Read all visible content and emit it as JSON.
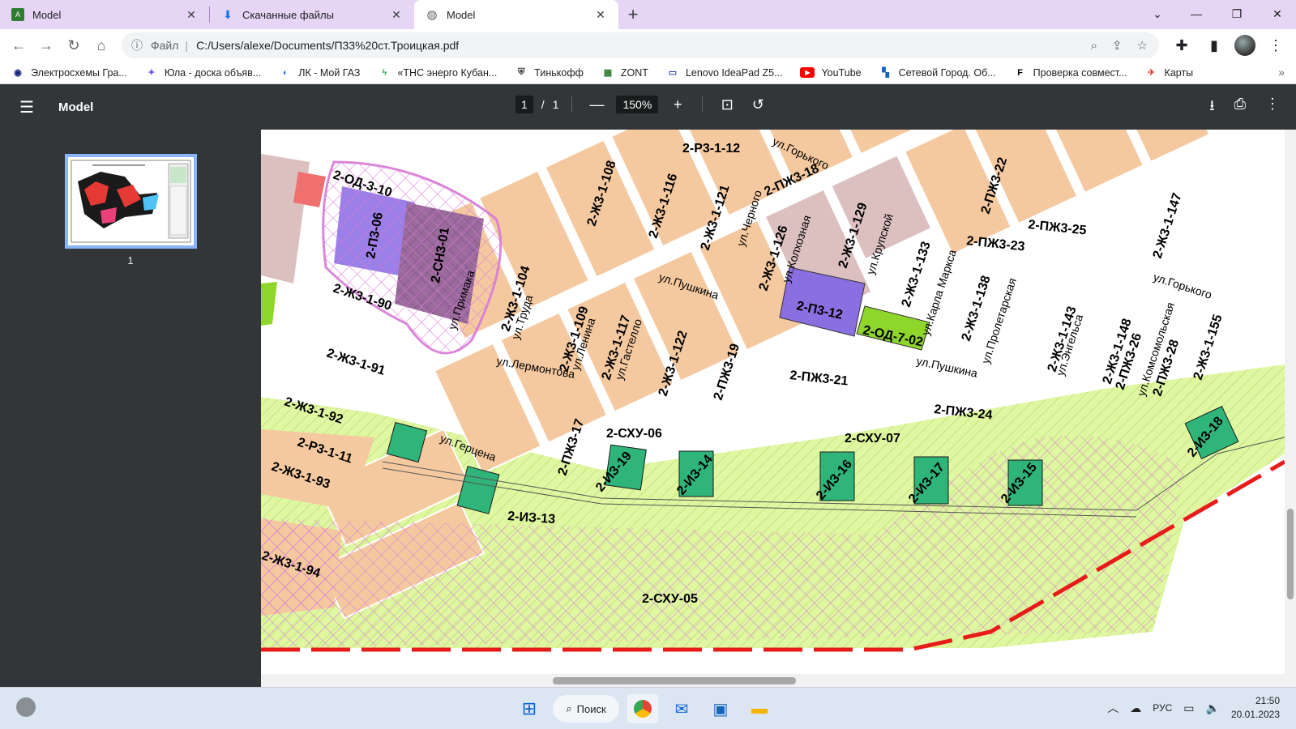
{
  "browser": {
    "tabs": [
      {
        "label": "Model",
        "icon": "autocad-icon",
        "active": false
      },
      {
        "label": "Скачанные файлы",
        "icon": "download-icon",
        "active": false
      },
      {
        "label": "Model",
        "icon": "globe-icon",
        "active": true
      }
    ],
    "address": {
      "scheme_label": "Файл",
      "url": "C:/Users/alexe/Documents/П33%20ст.Троицкая.pdf"
    },
    "bookmarks": [
      "Электросхемы Гра...",
      "Юла - доска объяв...",
      "ЛК - Мой ГАЗ",
      "«ТНС энерго Кубан...",
      "Тинькофф",
      "ZONT",
      "Lenovo IdeaPad Z5...",
      "YouTube",
      "Сетевой Город. Об...",
      "Проверка совмест...",
      "Карты"
    ]
  },
  "pdf": {
    "title": "Model",
    "page_current": "1",
    "page_sep": "/",
    "page_total": "1",
    "zoom": "150%",
    "thumbnail_label": "1"
  },
  "map": {
    "streets": [
      "ул.Пушкина",
      "ул.Пушкина",
      "ул.Горького",
      "ул.Горького",
      "ул.Лермонтова",
      "ул.Герцена",
      "ул.Черного",
      "ул.Колхозная",
      "ул.Крупской",
      "ул.Карла Маркса",
      "ул.Пролетарская",
      "ул.Энгельса",
      "ул.Комсомольская",
      "ул.Гастелло",
      "ул.Ленина",
      "ул.Труда",
      "ул.Примака"
    ],
    "zones": [
      "2-ОД-3-10",
      "2-П3-06",
      "2-СН3-01",
      "2-Ж3-1-90",
      "2-Ж3-1-91",
      "2-Ж3-1-92",
      "2-Ж3-1-93",
      "2-Ж3-1-94",
      "2-Р3-1-11",
      "2-Р3-1-12",
      "2-Ж3-1-104",
      "2-Ж3-1-108",
      "2-Ж3-1-109",
      "2-Ж3-1-116",
      "2-Ж3-1-117",
      "2-Ж3-1-121",
      "2-Ж3-1-122",
      "2-Ж3-1-126",
      "2-Ж3-1-129",
      "2-Ж3-1-133",
      "2-Ж3-1-138",
      "2-Ж3-1-143",
      "2-Ж3-1-147",
      "2-Ж3-1-148",
      "2-Ж3-1-155",
      "2-ПЖ3-19",
      "2-ПЖ3-21",
      "2-ПЖ3-22",
      "2-ПЖ3-23",
      "2-ПЖ3-24",
      "2-ПЖ3-25",
      "2-ПЖ3-26",
      "2-ПЖ3-28",
      "2-ПЖ3-18",
      "2-ПЖ3-17",
      "2-П3-12",
      "2-ОД-7-02",
      "2-СХУ-05",
      "2-СХУ-06",
      "2-СХУ-07",
      "2-ИЗ-13",
      "2-ИЗ-14",
      "2-ИЗ-15",
      "2-ИЗ-16",
      "2-ИЗ-17",
      "2-ИЗ-18",
      "2-ИЗ-19"
    ]
  },
  "taskbar": {
    "search_label": "Поиск",
    "language": "РУС",
    "time": "21:50",
    "date": "20.01.2023"
  },
  "colors": {
    "residential": "#f5c9a0",
    "mixed_residential": "#dcc0c0",
    "agricultural": "#dff7a0",
    "industrial": "#9a7fe8",
    "utility": "#2fb47a",
    "boundary": "#e81b1b",
    "protection_zone": "#d77bd7",
    "pdf_toolbar": "#323639"
  }
}
